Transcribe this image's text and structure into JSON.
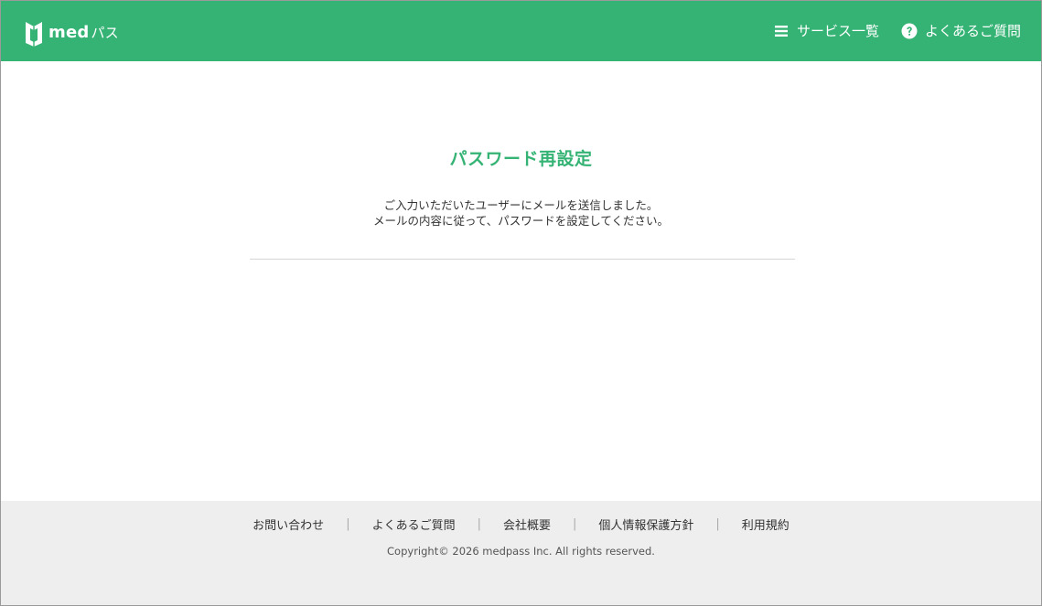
{
  "header": {
    "logo_text": "med",
    "logo_kana": "パス",
    "nav": [
      {
        "label": "サービス一覧",
        "icon": "menu-icon"
      },
      {
        "label": "よくあるご質問",
        "icon": "question-circle-icon"
      }
    ]
  },
  "main": {
    "title": "パスワード再設定",
    "message_line1": "ご入力いただいたユーザーにメールを送信しました。",
    "message_line2": "メールの内容に従って、パスワードを設定してください。"
  },
  "footer": {
    "links": [
      "お問い合わせ",
      "よくあるご質問",
      "会社概要",
      "個人情報保護方針",
      "利用規約"
    ],
    "separator": "|",
    "copyright": "Copyright© 2026 medpass Inc. All rights reserved."
  },
  "colors": {
    "brand": "#35b374",
    "footer_bg": "#eeeeee",
    "text": "#333333"
  }
}
